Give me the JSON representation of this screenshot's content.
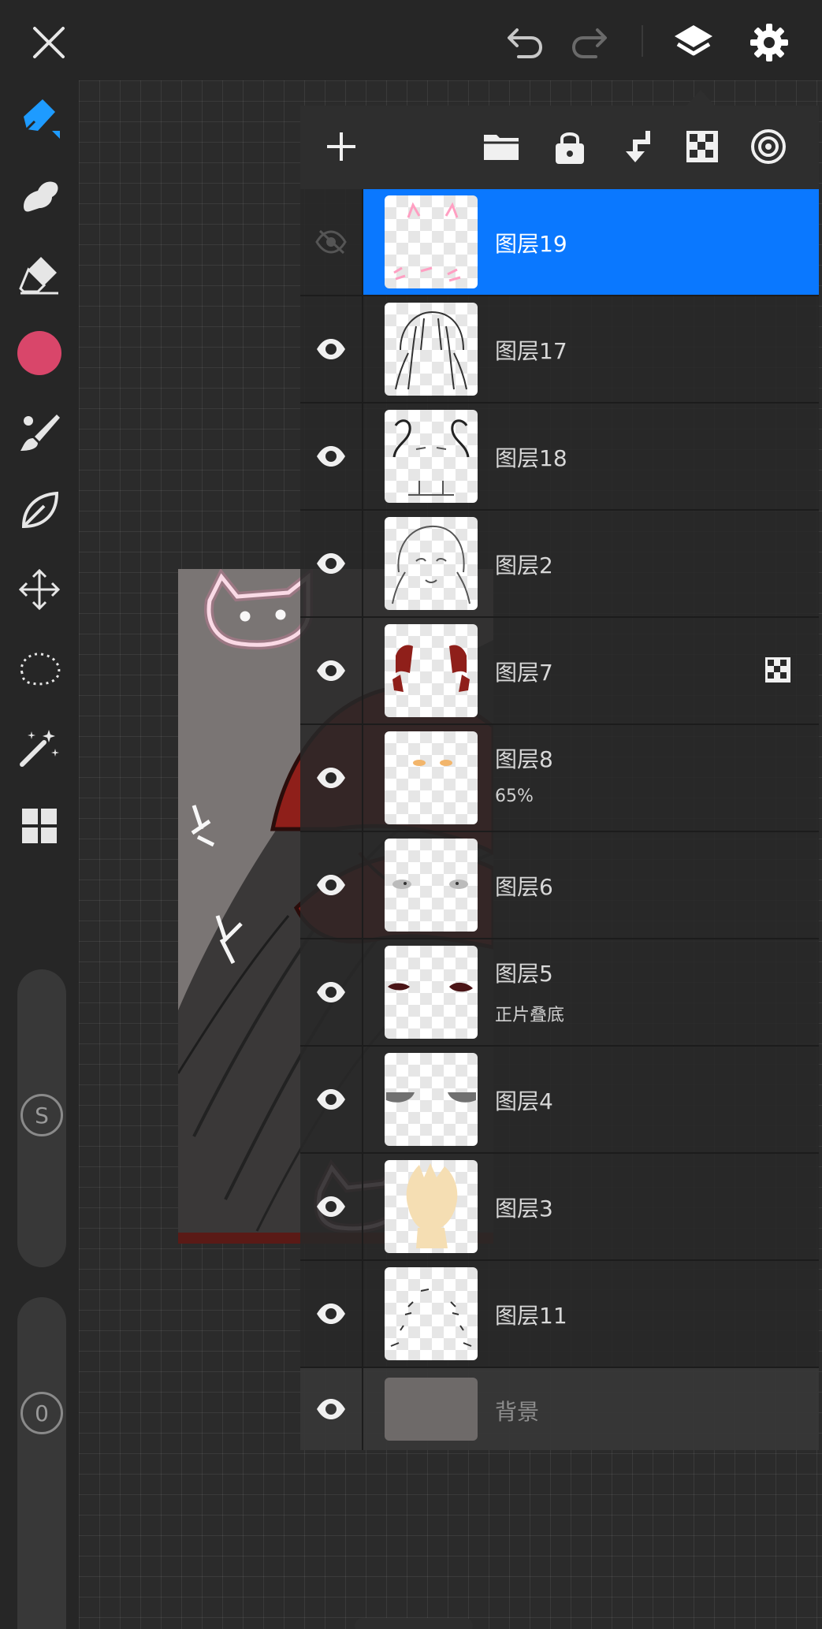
{
  "toolbar_top": {
    "close_icon": "close-icon",
    "undo_icon": "undo-icon",
    "redo_icon": "redo-icon",
    "layers_icon": "layers-icon",
    "settings_icon": "gear-icon"
  },
  "tools": [
    {
      "name": "pen-tool",
      "icon": "pen-icon"
    },
    {
      "name": "smudge-tool",
      "icon": "smudge-icon"
    },
    {
      "name": "eraser-tool",
      "icon": "eraser-icon"
    },
    {
      "name": "color-swatch",
      "icon": "color-circle",
      "color": "#d9466a"
    },
    {
      "name": "brush-settings",
      "icon": "brush-icon"
    },
    {
      "name": "leaf-tool",
      "icon": "leaf-icon"
    },
    {
      "name": "transform-tool",
      "icon": "move-icon"
    },
    {
      "name": "lasso-tool",
      "icon": "lasso-icon"
    },
    {
      "name": "magic-wand-tool",
      "icon": "magic-wand-icon"
    },
    {
      "name": "gallery-tool",
      "icon": "grid-icon"
    }
  ],
  "sliders": {
    "size_label": "S",
    "opacity_label": "0"
  },
  "layers_panel": {
    "header_buttons": [
      "add-layer-icon",
      "folder-icon",
      "lock-icon",
      "merge-down-icon",
      "alpha-lock-icon",
      "blend-icon"
    ],
    "layers": [
      {
        "label": "图层19",
        "sub": "",
        "visible": false,
        "selected": true,
        "alpha_lock": false
      },
      {
        "label": "图层17",
        "sub": "",
        "visible": true,
        "selected": false,
        "alpha_lock": false
      },
      {
        "label": "图层18",
        "sub": "",
        "visible": true,
        "selected": false,
        "alpha_lock": false
      },
      {
        "label": "图层2",
        "sub": "",
        "visible": true,
        "selected": false,
        "alpha_lock": false
      },
      {
        "label": "图层7",
        "sub": "",
        "visible": true,
        "selected": false,
        "alpha_lock": true
      },
      {
        "label": "图层8",
        "sub": "65%",
        "visible": true,
        "selected": false,
        "alpha_lock": false
      },
      {
        "label": "图层6",
        "sub": "",
        "visible": true,
        "selected": false,
        "alpha_lock": false
      },
      {
        "label": "图层5",
        "sub": "正片叠底",
        "visible": true,
        "selected": false,
        "alpha_lock": false
      },
      {
        "label": "图层4",
        "sub": "",
        "visible": true,
        "selected": false,
        "alpha_lock": false
      },
      {
        "label": "图层3",
        "sub": "",
        "visible": true,
        "selected": false,
        "alpha_lock": false
      },
      {
        "label": "图层11",
        "sub": "",
        "visible": true,
        "selected": false,
        "alpha_lock": false
      }
    ],
    "background_layer": {
      "label": "背景",
      "visible": true
    }
  },
  "colors": {
    "accent": "#0a78ff",
    "primary_color": "#d9466a"
  }
}
